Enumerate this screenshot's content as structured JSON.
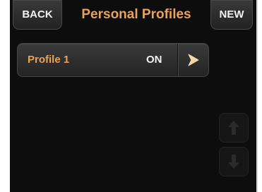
{
  "header": {
    "back_label": "BACK",
    "title": "Personal Profiles",
    "new_label": "NEW"
  },
  "profiles": [
    {
      "name": "Profile 1",
      "status": "ON",
      "arrow_icon": "chevron-right-icon"
    }
  ],
  "scroll": {
    "up_icon": "arrow-up-icon",
    "down_icon": "arrow-down-icon"
  },
  "colors": {
    "accent": "#e8a35a",
    "background": "#0d0d0d",
    "text": "#f2f2f2"
  }
}
